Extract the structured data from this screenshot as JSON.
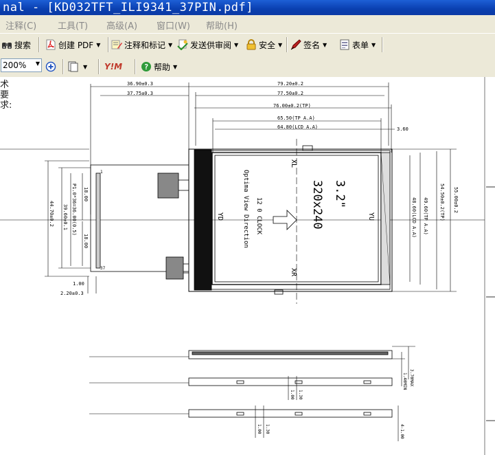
{
  "window": {
    "title": "nal - [KD032TFT_ILI9341_37PIN.pdf]"
  },
  "menu": [
    {
      "label": "注释(C)"
    },
    {
      "label": "工具(T)"
    },
    {
      "label": "高级(A)"
    },
    {
      "label": "窗口(W)"
    },
    {
      "label": "帮助(H)"
    }
  ],
  "toolbar1": {
    "search": "搜索",
    "create_pdf": "创建 PDF",
    "comment": "注释和标记",
    "review": "发送供审阅",
    "security": "安全",
    "sign": "签名",
    "forms": "表单"
  },
  "toolbar2": {
    "zoom": "200%",
    "yahoo": "Y!M",
    "help": "帮助"
  },
  "document": {
    "side_note": "术要求:",
    "dims": {
      "d1": "36.90±0.3",
      "d2": "37.75±0.3",
      "d3": "79.20±0.2",
      "d4": "77.50±0.2",
      "d5": "76.00±0.2(TP)",
      "d6": "65.50(TP A.A)",
      "d7": "64.80(LCD A.A)",
      "d8": "3.60",
      "d9": "55.00±0.2",
      "d10": "54.50±0.2(TP)",
      "d11": "49.60(TP A.A)",
      "d12": "48.60(LCD A.A)",
      "d13": "44.70±0.2",
      "d14": "39.60±0.1",
      "d15": "P1.0*36=36.00(0.5)",
      "d16": "18.00",
      "d17": "18.00",
      "d18": "1.00",
      "d19": "2.20±0.3",
      "d20": "3.70MAX",
      "d21": "1.40MIN",
      "d22": "1.00",
      "d23": "1.30",
      "d24": "1.00",
      "d25": "1.30",
      "d26": "4-1.00"
    },
    "screen": {
      "size": "3.2\"",
      "resolution": "320x240",
      "optima1": "12 0 CLOCK",
      "optima2": "Optima View Direction",
      "xl": "XL",
      "xr": "XR",
      "yd": "YD",
      "yu": "YU"
    },
    "pins": {
      "p1": "1",
      "p37": "37"
    }
  },
  "colors": {
    "titlebar": "#0a3fb0",
    "chrome": "#ece9d8",
    "accent_red": "#c0392b"
  }
}
